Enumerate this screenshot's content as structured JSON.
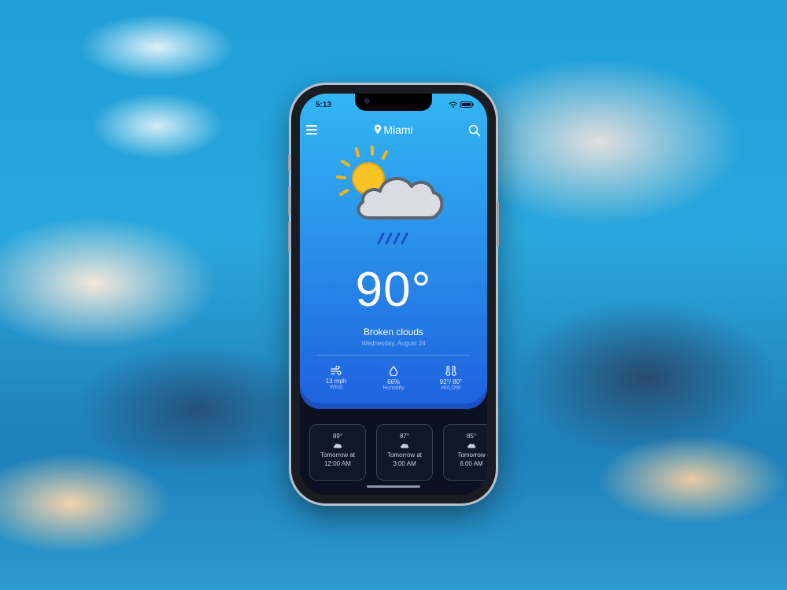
{
  "status_bar": {
    "time": "5:13"
  },
  "header": {
    "city": "Miami"
  },
  "current": {
    "icon": "sun-behind-rain-cloud-icon",
    "temperature": "90°",
    "condition": "Broken clouds",
    "date": "Wednesday, August 24"
  },
  "stats": [
    {
      "icon": "wind-icon",
      "value": "13 mph",
      "label": "Wind"
    },
    {
      "icon": "droplet-icon",
      "value": "66%",
      "label": "Humidity"
    },
    {
      "icon": "thermometer-icon",
      "value": "92°/ 80°",
      "label": "HI/LOW"
    }
  ],
  "hourly": [
    {
      "temp": "89°",
      "icon": "cloud-icon",
      "label": "Tomorrow at",
      "time": "12:00 AM"
    },
    {
      "temp": "87°",
      "icon": "cloud-icon",
      "label": "Tomorrow at",
      "time": "3:00 AM"
    },
    {
      "temp": "85°",
      "icon": "cloud-icon",
      "label": "Tomorrow",
      "time": "6:00 AM"
    }
  ],
  "colors": {
    "card_top": "#33b6f4",
    "card_bottom": "#1f62df",
    "screen_bg": "#0b1120",
    "sun": "#f7c325",
    "cloud": "#d9dde3"
  }
}
